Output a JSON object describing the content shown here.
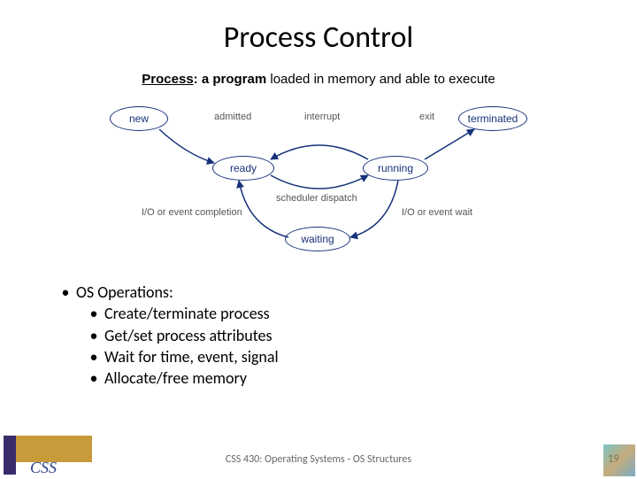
{
  "title": "Process Control",
  "subtitle": {
    "w1": "Process",
    "w2": ": a program",
    "rest": " loaded in memory and able to execute"
  },
  "diagram": {
    "nodes": {
      "new": "new",
      "terminated": "terminated",
      "ready": "ready",
      "running": "running",
      "waiting": "waiting"
    },
    "labels": {
      "admitted": "admitted",
      "interrupt": "interrupt",
      "exit": "exit",
      "io_complete": "I/O or event completion",
      "sched": "scheduler dispatch",
      "io_wait": "I/O or event wait"
    }
  },
  "bullets": {
    "top": "OS Operations:",
    "items": [
      "Create/terminate process",
      "Get/set process attributes",
      "Wait for time, event, signal",
      "Allocate/free memory"
    ]
  },
  "footer": "CSS 430: Operating Systems - OS Structures",
  "page": "19",
  "logo_text": "CSS"
}
